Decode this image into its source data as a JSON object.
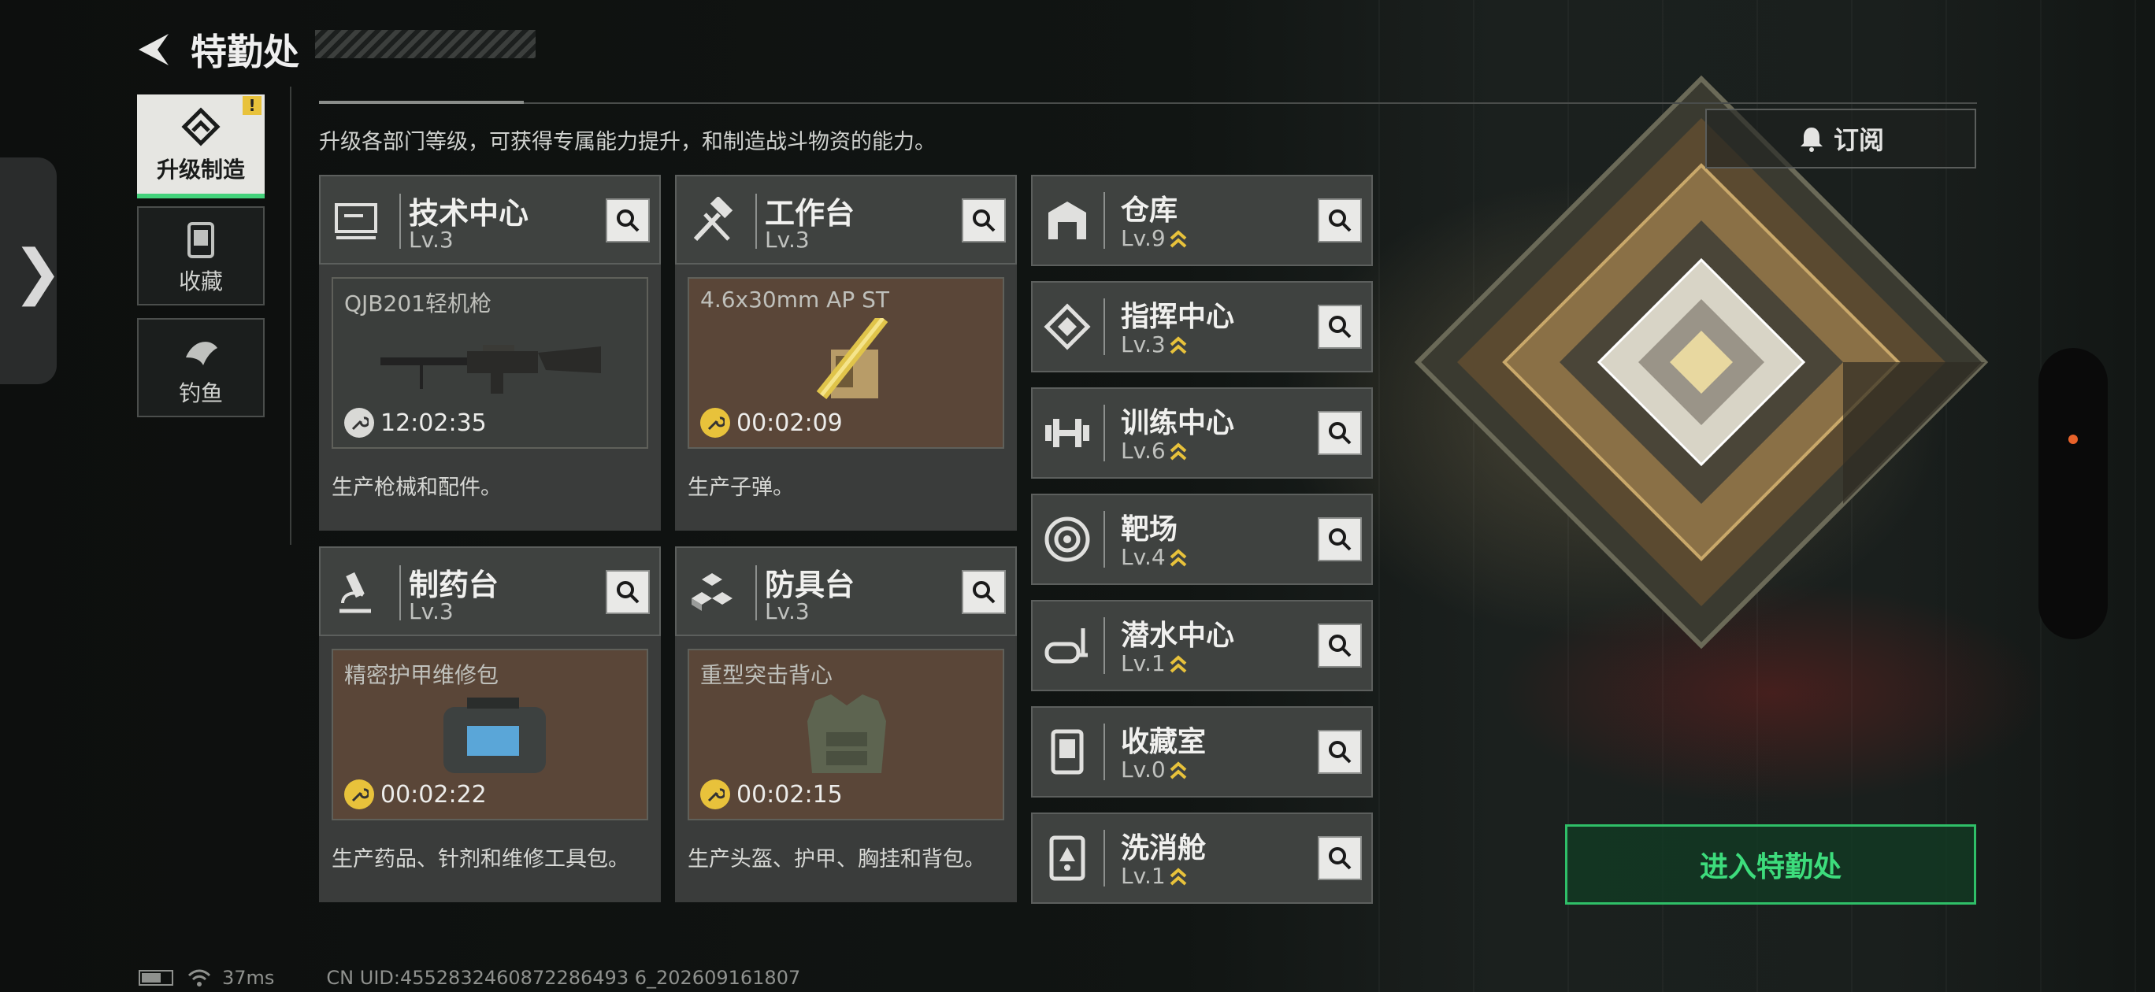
{
  "header": {
    "title": "特勤处"
  },
  "nav": [
    {
      "label": "升级制造",
      "icon": "upgrade-icon",
      "active": true,
      "badge": "!"
    },
    {
      "label": "收藏",
      "icon": "collection-icon",
      "active": false
    },
    {
      "label": "钓鱼",
      "icon": "fish-icon",
      "active": false
    }
  ],
  "description": "升级各部门等级，可获得专属能力提升，和制造战斗物资的能力。",
  "subscribe_label": "订阅",
  "cards": [
    {
      "name": "技术中心",
      "level": "Lv.3",
      "product": "QJB201轻机枪",
      "timer": "12:02:35",
      "desc": "生产枪械和配件。",
      "icon": "tech-center-icon"
    },
    {
      "name": "工作台",
      "level": "Lv.3",
      "product": "4.6x30mm AP ST",
      "timer": "00:02:09",
      "desc": "生产子弹。",
      "icon": "hammer-icon"
    },
    {
      "name": "制药台",
      "level": "Lv.3",
      "product": "精密护甲维修包",
      "timer": "00:02:22",
      "desc": "生产药品、针剂和维修工具包。",
      "icon": "microscope-icon"
    },
    {
      "name": "防具台",
      "level": "Lv.3",
      "product": "重型突击背心",
      "timer": "00:02:15",
      "desc": "生产头盔、护甲、胸挂和背包。",
      "icon": "armor-blocks-icon"
    }
  ],
  "facilities": [
    {
      "name": "仓库",
      "level": "Lv.9",
      "icon": "warehouse-icon"
    },
    {
      "name": "指挥中心",
      "level": "Lv.3",
      "icon": "command-icon"
    },
    {
      "name": "训练中心",
      "level": "Lv.6",
      "icon": "dumbbell-icon"
    },
    {
      "name": "靶场",
      "level": "Lv.4",
      "icon": "target-icon"
    },
    {
      "name": "潜水中心",
      "level": "Lv.1",
      "icon": "diving-mask-icon"
    },
    {
      "name": "收藏室",
      "level": "Lv.0",
      "icon": "collection-room-icon"
    },
    {
      "name": "洗消舱",
      "level": "Lv.1",
      "icon": "decon-icon"
    }
  ],
  "enter_label": "进入特勤处",
  "status": {
    "ping": "37ms",
    "uid": "CN UID:4552832460872286493 6_202609161807"
  },
  "colors": {
    "accent": "#43d27b",
    "warning": "#e8c23b",
    "upgrade": "#e8c23b"
  }
}
